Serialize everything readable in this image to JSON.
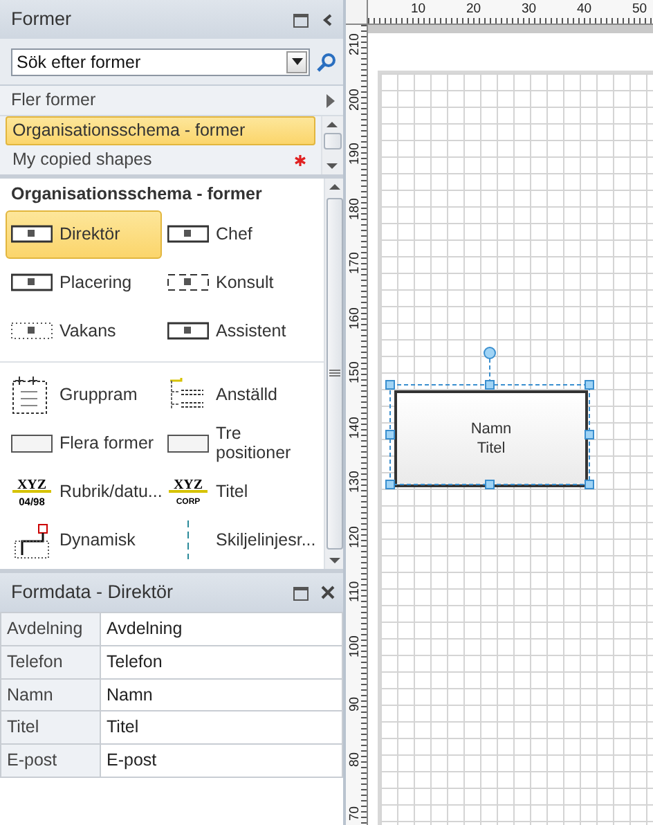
{
  "stencil_panel": {
    "title": "Former",
    "search": {
      "placeholder": "Sök efter former"
    },
    "more_shapes": "Fler former",
    "stencils": [
      {
        "label": "Organisationsschema - former",
        "selected": true,
        "unsaved": false
      },
      {
        "label": "My copied shapes",
        "selected": false,
        "unsaved": true
      }
    ],
    "shapes_title": "Organisationsschema - former",
    "shape_groups": [
      [
        {
          "label": "Direktör",
          "kind": "box",
          "selected": true
        },
        {
          "label": "Chef",
          "kind": "box",
          "selected": false
        },
        {
          "label": "Placering",
          "kind": "box",
          "selected": false
        },
        {
          "label": "Konsult",
          "kind": "dashed",
          "selected": false
        },
        {
          "label": "Vakans",
          "kind": "dotted",
          "selected": false
        },
        {
          "label": "Assistent",
          "kind": "box",
          "selected": false
        }
      ],
      [
        {
          "label": "Gruppram",
          "kind": "frame",
          "selected": false
        },
        {
          "label": "Anställd",
          "kind": "staff",
          "selected": false
        },
        {
          "label": "Flera former",
          "kind": "plain",
          "selected": false
        },
        {
          "label": "Tre positioner",
          "kind": "plain",
          "selected": false
        },
        {
          "label": "Rubrik/datu...",
          "kind": "xyz-date",
          "selected": false,
          "icon_text": [
            "XYZ",
            "04/98"
          ]
        },
        {
          "label": "Titel",
          "kind": "xyz-corp",
          "selected": false,
          "icon_text": [
            "XYZ",
            "CORP"
          ]
        },
        {
          "label": "Dynamisk",
          "kind": "connector",
          "selected": false
        },
        {
          "label": "Skiljelinjesr...",
          "kind": "line",
          "selected": false
        }
      ]
    ]
  },
  "shape_data": {
    "title": "Formdata - Direktör",
    "rows": [
      {
        "label": "Avdelning",
        "value": "Avdelning"
      },
      {
        "label": "Telefon",
        "value": "Telefon"
      },
      {
        "label": "Namn",
        "value": "Namn"
      },
      {
        "label": "Titel",
        "value": "Titel"
      },
      {
        "label": "E-post",
        "value": "E-post"
      }
    ]
  },
  "canvas": {
    "top_ruler": [
      "10",
      "20",
      "30",
      "40",
      "50"
    ],
    "left_ruler": [
      "210",
      "200",
      "190",
      "180",
      "170",
      "160",
      "150",
      "140",
      "130",
      "120",
      "110",
      "100",
      "90",
      "80",
      "70"
    ],
    "shape": {
      "lines": [
        "Namn",
        "Titel"
      ],
      "selected": true
    }
  }
}
